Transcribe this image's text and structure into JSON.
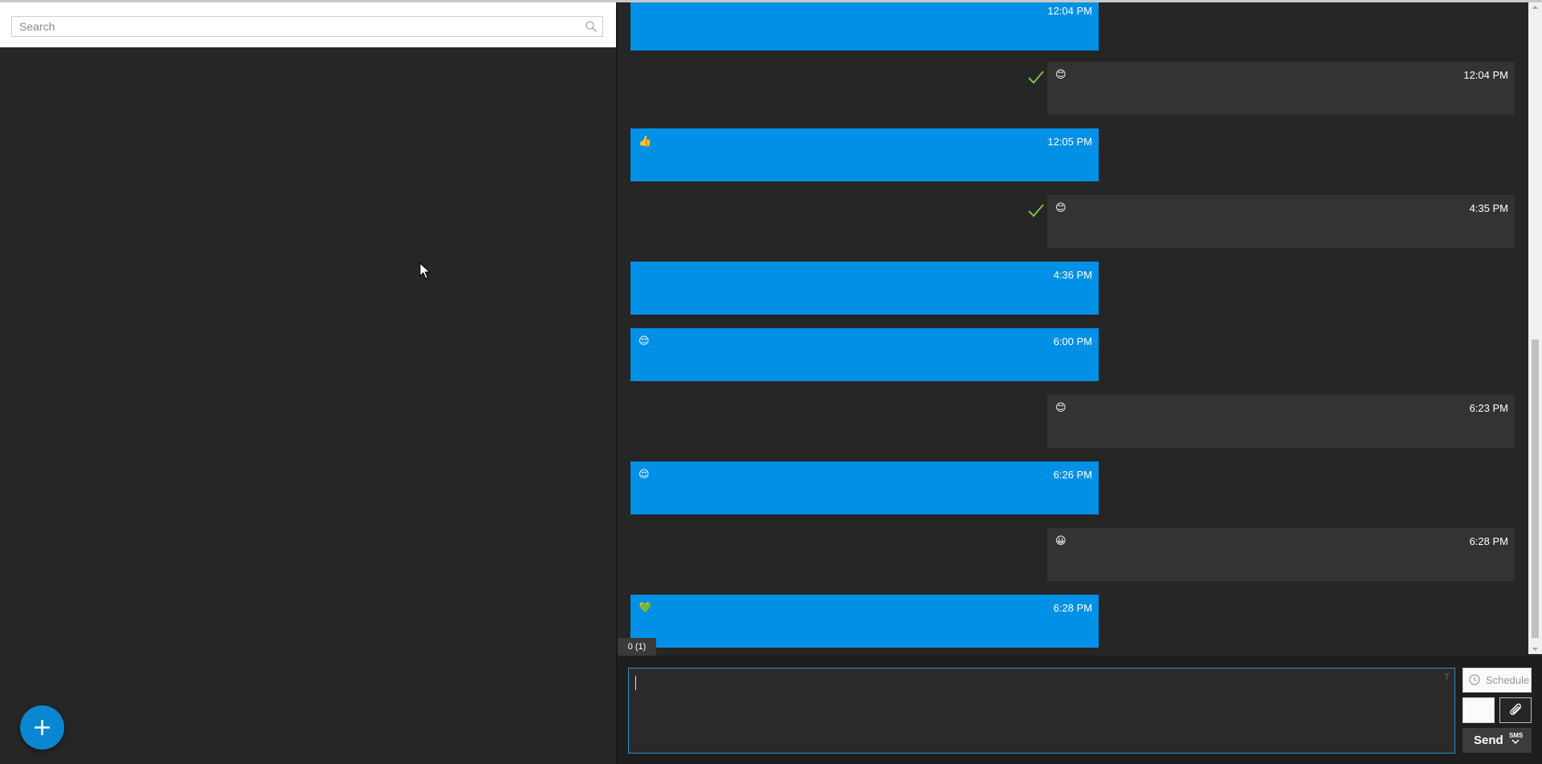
{
  "search": {
    "placeholder": "Search"
  },
  "fab": {
    "label": "+"
  },
  "chat": {
    "messages": [
      {
        "direction": "out",
        "emoji": "",
        "time": "12:04 PM",
        "read": false
      },
      {
        "direction": "in",
        "emoji": "😊",
        "time": "12:04 PM",
        "read": true
      },
      {
        "direction": "out",
        "emoji": "👍",
        "time": "12:05 PM",
        "read": false
      },
      {
        "direction": "in",
        "emoji": "😊",
        "time": "4:35 PM",
        "read": true
      },
      {
        "direction": "out",
        "emoji": "",
        "time": "4:36 PM",
        "read": false
      },
      {
        "direction": "out",
        "emoji": "😌",
        "time": "6:00 PM",
        "read": false
      },
      {
        "direction": "in",
        "emoji": "😊",
        "time": "6:23 PM",
        "read": false
      },
      {
        "direction": "out",
        "emoji": "😌",
        "time": "6:26 PM",
        "read": false
      },
      {
        "direction": "in",
        "emoji": "😀",
        "time": "6:28 PM",
        "read": false
      },
      {
        "direction": "out",
        "emoji": "💚",
        "time": "6:28 PM",
        "read": false
      }
    ]
  },
  "compose": {
    "counter": "0 (1)",
    "value": "",
    "format_icon": "T",
    "schedule_label": "Schedule",
    "emoji_button": "😞",
    "send_label": "Send",
    "sms_badge": "SMS"
  },
  "colors": {
    "outgoing_bubble": "#0090e6",
    "incoming_bubble": "#333333",
    "background": "#262626",
    "accent": "#0a87d1",
    "check": "#7cc242"
  }
}
